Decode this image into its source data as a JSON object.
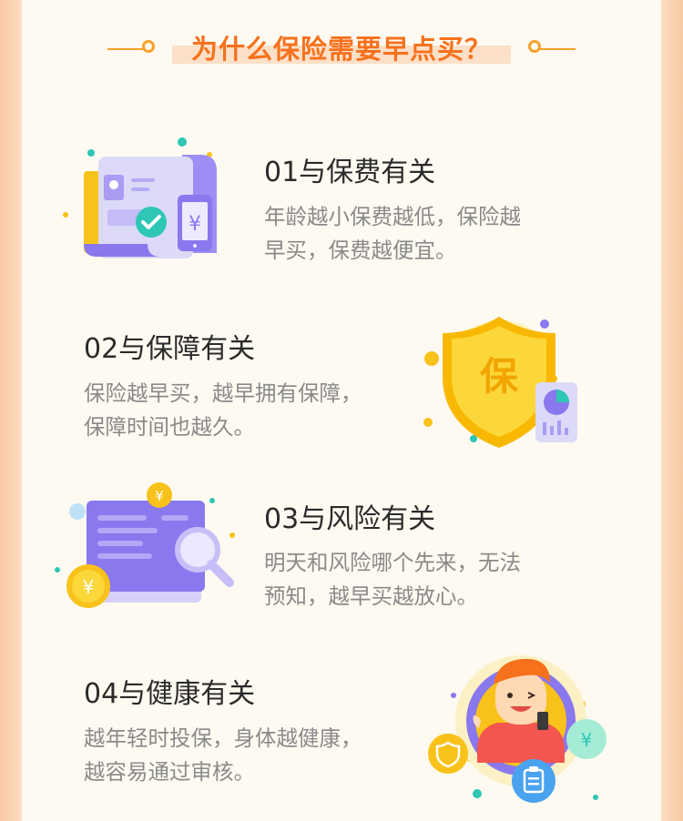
{
  "header": {
    "title": "为什么保险需要早点买？"
  },
  "sections": [
    {
      "title": "01与保费有关",
      "lines": [
        "年龄越小保费越低，保险越",
        "早买，保费越便宜。"
      ]
    },
    {
      "title": "02与保障有关",
      "lines": [
        "保险越早买，越早拥有保障，",
        "保障时间也越久。"
      ]
    },
    {
      "title": "03与风险有关",
      "lines": [
        "明天和风险哪个先来，无法",
        "预知，越早买越放心。"
      ]
    },
    {
      "title": "04与健康有关",
      "lines": [
        "越年轻时投保，身体越健康，",
        "越容易通过审核。"
      ]
    }
  ],
  "icons": {
    "shield_char": "保",
    "currency": "¥"
  },
  "colors": {
    "accent": "#f7711c",
    "deco": "#f7a12a",
    "title_text": "#2b2b2b",
    "body_text": "#8a8a8a",
    "purple": "#8a78ee",
    "gold": "#f9c21a",
    "teal": "#2ec6b5"
  }
}
